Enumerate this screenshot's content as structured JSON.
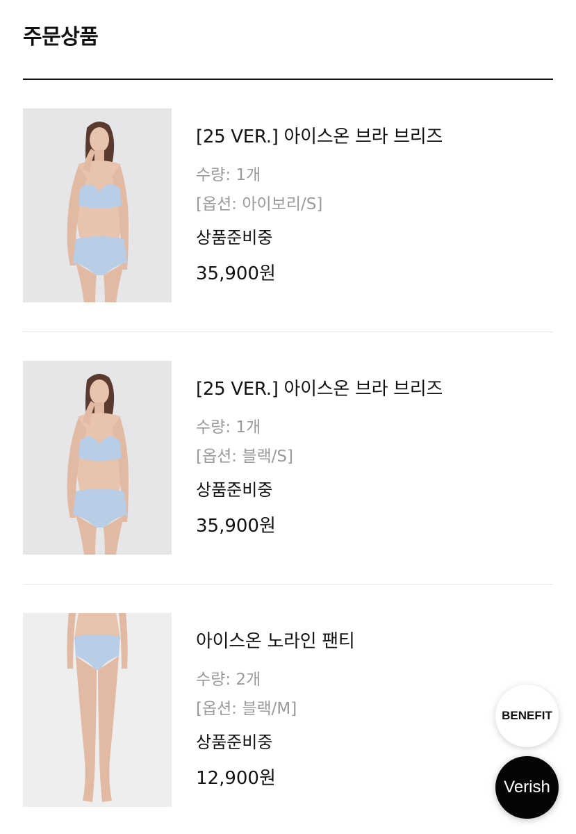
{
  "section": {
    "title": "주문상품"
  },
  "items": [
    {
      "name": "[25 VER.] 아이스온 브라 브리즈",
      "quantity": "수량: 1개",
      "option": "[옵션: 아이보리/S]",
      "status": "상품준비중",
      "price": "35,900원",
      "image_icon": "model-bra-set-photo"
    },
    {
      "name": "[25 VER.] 아이스온 브라 브리즈",
      "quantity": "수량: 1개",
      "option": "[옵션: 블랙/S]",
      "status": "상품준비중",
      "price": "35,900원",
      "image_icon": "model-bra-set-photo"
    },
    {
      "name": "아이스온 노라인 팬티",
      "quantity": "수량: 2개",
      "option": "[옵션: 블랙/M]",
      "status": "상품준비중",
      "price": "12,900원",
      "image_icon": "model-panty-photo"
    }
  ],
  "floating": {
    "benefit_label": "BENEFIT",
    "verish_label": "Verish"
  },
  "colors": {
    "product_blue": "#b9cde6",
    "image_background": "#e6e6e8",
    "muted_text": "#9a9a9a"
  }
}
